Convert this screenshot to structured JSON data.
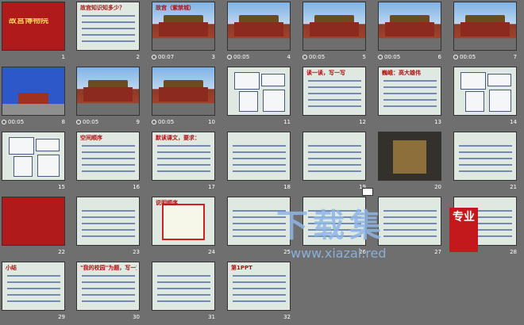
{
  "slides": [
    {
      "num": "1",
      "time": "",
      "variant": "red",
      "title": "故宫博物院"
    },
    {
      "num": "2",
      "time": "",
      "variant": "text",
      "title": "故宫知识知多少？"
    },
    {
      "num": "3",
      "time": "00:07",
      "variant": "photo",
      "title": "故宫（紫禁城）"
    },
    {
      "num": "4",
      "time": "00:05",
      "variant": "photo",
      "title": ""
    },
    {
      "num": "5",
      "time": "00:05",
      "variant": "photo",
      "title": ""
    },
    {
      "num": "6",
      "time": "00:05",
      "variant": "photo",
      "title": ""
    },
    {
      "num": "7",
      "time": "00:05",
      "variant": "photo",
      "title": ""
    },
    {
      "num": "8",
      "time": "00:05",
      "variant": "blue",
      "title": ""
    },
    {
      "num": "9",
      "time": "00:05",
      "variant": "photo",
      "title": ""
    },
    {
      "num": "10",
      "time": "00:05",
      "variant": "photo",
      "title": ""
    },
    {
      "num": "11",
      "time": "",
      "variant": "diagram",
      "title": ""
    },
    {
      "num": "12",
      "time": "",
      "variant": "text",
      "title": "读一读，写一写"
    },
    {
      "num": "13",
      "time": "",
      "variant": "text",
      "title": "巍峨：高大雄伟"
    },
    {
      "num": "14",
      "time": "",
      "variant": "diagram",
      "title": ""
    },
    {
      "num": "15",
      "time": "",
      "variant": "diagram",
      "title": ""
    },
    {
      "num": "16",
      "time": "",
      "variant": "text",
      "title": "空间顺序"
    },
    {
      "num": "17",
      "time": "",
      "variant": "text",
      "title": "默读课文，要求："
    },
    {
      "num": "18",
      "time": "",
      "variant": "text",
      "title": ""
    },
    {
      "num": "19",
      "time": "",
      "variant": "text",
      "title": ""
    },
    {
      "num": "20",
      "time": "",
      "variant": "dark",
      "title": ""
    },
    {
      "num": "21",
      "time": "",
      "variant": "text",
      "title": ""
    },
    {
      "num": "22",
      "time": "",
      "variant": "red",
      "title": ""
    },
    {
      "num": "23",
      "time": "",
      "variant": "text",
      "title": ""
    },
    {
      "num": "24",
      "time": "",
      "variant": "redframe",
      "title": "说明顺序"
    },
    {
      "num": "25",
      "time": "",
      "variant": "text",
      "title": ""
    },
    {
      "num": "26",
      "time": "",
      "variant": "text",
      "title": ""
    },
    {
      "num": "27",
      "time": "",
      "variant": "text",
      "title": ""
    },
    {
      "num": "28",
      "time": "",
      "variant": "text",
      "title": ""
    },
    {
      "num": "29",
      "time": "",
      "variant": "text",
      "title": "小结"
    },
    {
      "num": "30",
      "time": "",
      "variant": "text",
      "title": "\"我的校园\"为题，写一篇说明文。"
    },
    {
      "num": "31",
      "time": "",
      "variant": "text",
      "title": ""
    },
    {
      "num": "32",
      "time": "",
      "variant": "text",
      "title": "第1PPT"
    }
  ],
  "watermark": {
    "main": "下载集",
    "url": "www.xiazai.red",
    "seal": "专业"
  }
}
